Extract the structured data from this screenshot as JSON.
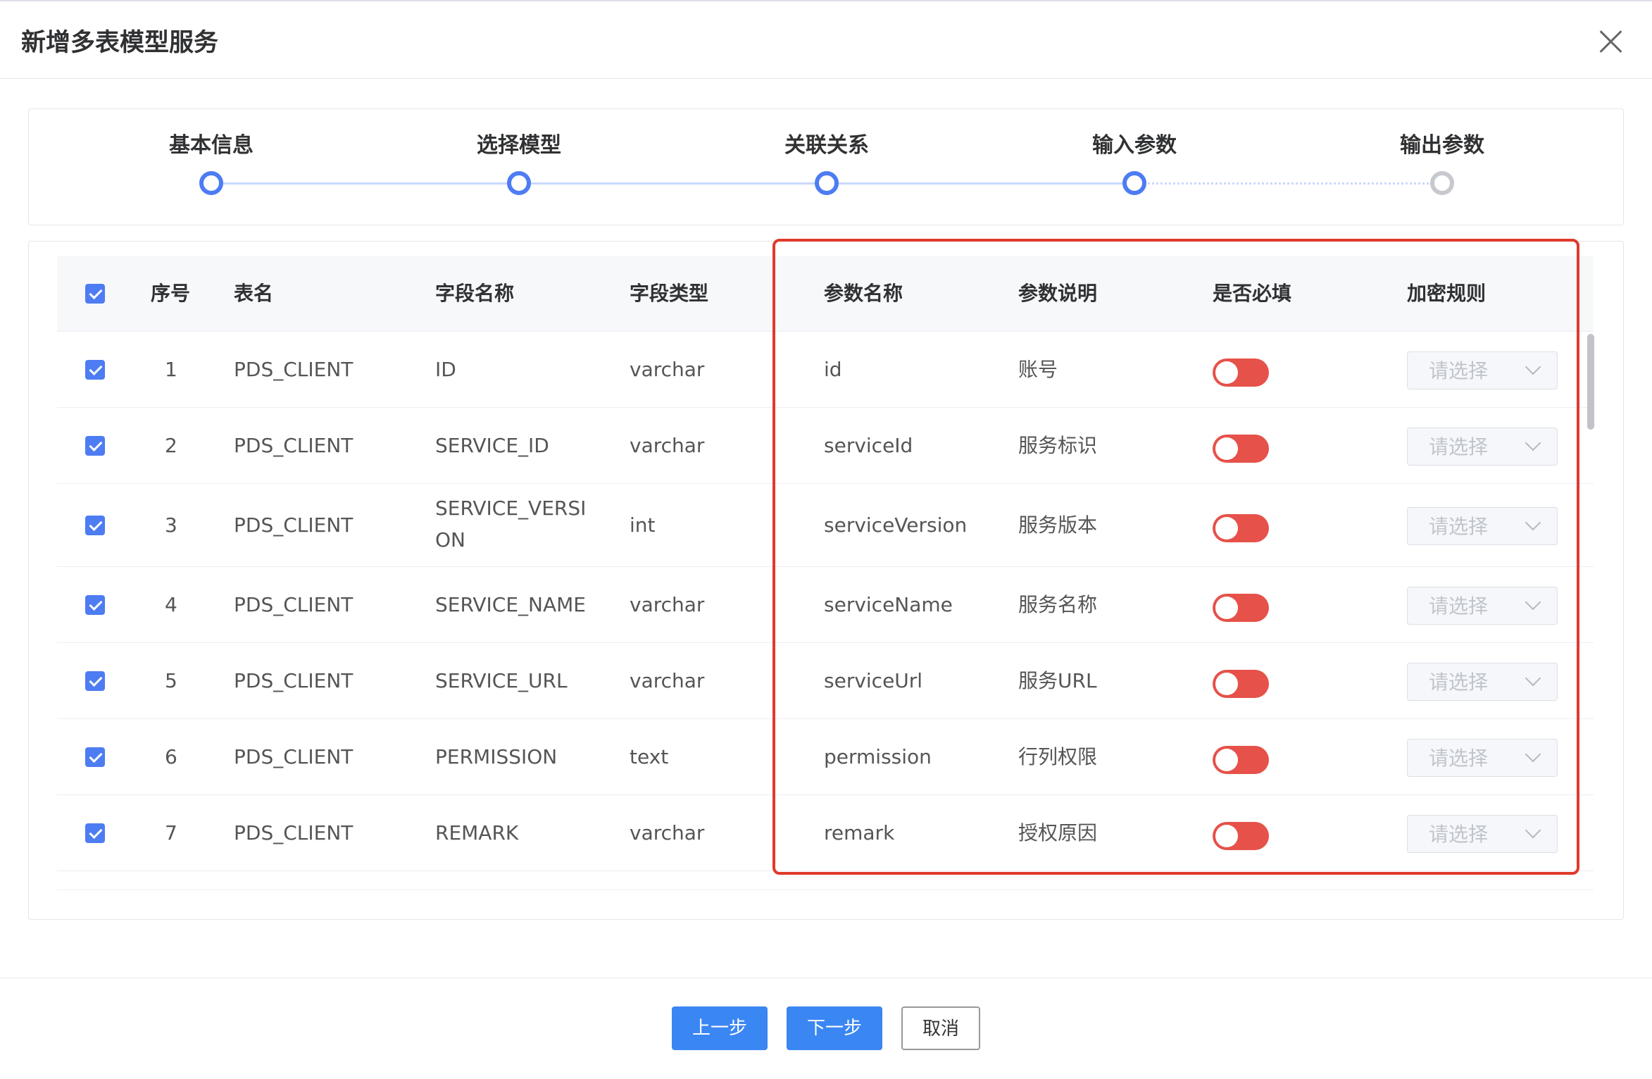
{
  "dialog": {
    "title": "新增多表模型服务"
  },
  "steps": [
    {
      "label": "基本信息"
    },
    {
      "label": "选择模型"
    },
    {
      "label": "关联关系"
    },
    {
      "label": "输入参数"
    },
    {
      "label": "输出参数"
    }
  ],
  "table": {
    "headers": {
      "index": "序号",
      "table_name": "表名",
      "field_name": "字段名称",
      "field_type": "字段类型",
      "param_name": "参数名称",
      "param_desc": "参数说明",
      "required": "是否必填",
      "encrypt_rule": "加密规则"
    },
    "rows": [
      {
        "index": "1",
        "table_name": "PDS_CLIENT",
        "field_name": "ID",
        "field_type": "varchar",
        "param_name": "id",
        "param_desc": "账号",
        "encrypt_placeholder": "请选择"
      },
      {
        "index": "2",
        "table_name": "PDS_CLIENT",
        "field_name": "SERVICE_ID",
        "field_type": "varchar",
        "param_name": "serviceId",
        "param_desc": "服务标识",
        "encrypt_placeholder": "请选择"
      },
      {
        "index": "3",
        "table_name": "PDS_CLIENT",
        "field_name": "SERVICE_VERSI",
        "field_name_wrap": "ON",
        "field_type": "int",
        "param_name": "serviceVersion",
        "param_desc": "服务版本",
        "encrypt_placeholder": "请选择"
      },
      {
        "index": "4",
        "table_name": "PDS_CLIENT",
        "field_name": "SERVICE_NAME",
        "field_type": "varchar",
        "param_name": "serviceName",
        "param_desc": "服务名称",
        "encrypt_placeholder": "请选择"
      },
      {
        "index": "5",
        "table_name": "PDS_CLIENT",
        "field_name": "SERVICE_URL",
        "field_type": "varchar",
        "param_name": "serviceUrl",
        "param_desc": "服务URL",
        "encrypt_placeholder": "请选择"
      },
      {
        "index": "6",
        "table_name": "PDS_CLIENT",
        "field_name": "PERMISSION",
        "field_type": "text",
        "param_name": "permission",
        "param_desc": "行列权限",
        "encrypt_placeholder": "请选择"
      },
      {
        "index": "7",
        "table_name": "PDS_CLIENT",
        "field_name": "REMARK",
        "field_type": "varchar",
        "param_name": "remark",
        "param_desc": "授权原因",
        "encrypt_placeholder": "请选择"
      }
    ]
  },
  "footer": {
    "prev_label": "上一步",
    "next_label": "下一步",
    "cancel_label": "取消"
  },
  "colors": {
    "primary": "#4d7cf3",
    "switch_off": "#e6514a",
    "highlight": "#e03a2c"
  }
}
